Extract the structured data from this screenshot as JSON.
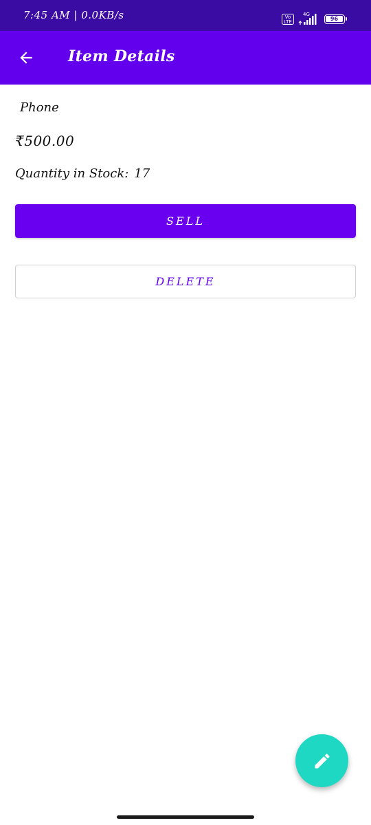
{
  "status_bar": {
    "time_speed": "7:45 AM | 0.0KB/s",
    "volte_label": "Vo LTE",
    "network_label": "4G",
    "battery_level": "96"
  },
  "app_bar": {
    "title": "Item Details",
    "back_icon": "arrow-back-icon"
  },
  "item": {
    "name": "Phone",
    "price": "₹500.00",
    "stock_label": "Quantity in Stock:",
    "stock_value": "17"
  },
  "actions": {
    "sell_label": "SELL",
    "delete_label": "DELETE"
  },
  "fab": {
    "icon": "edit-pencil-icon"
  },
  "colors": {
    "status_bar": "#3a0ca3",
    "app_bar": "#6200ee",
    "sell_button": "#6a00f0",
    "delete_text": "#6200ee",
    "fab": "#1ed8c4"
  }
}
